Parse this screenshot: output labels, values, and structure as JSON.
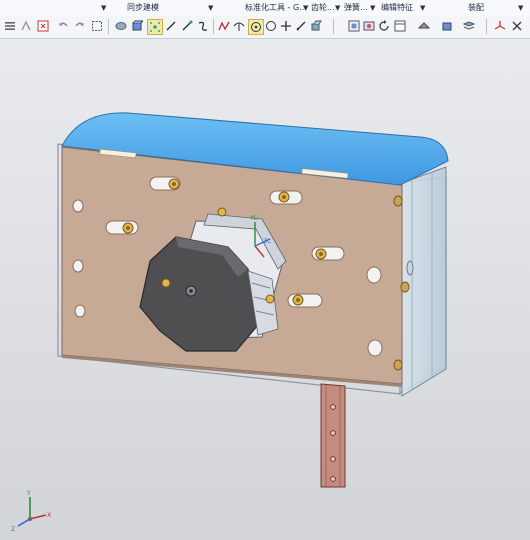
{
  "ribbon": {
    "groups": [
      {
        "label": "同步建模"
      },
      {
        "label": "标准化工具 - G..."
      },
      {
        "label": "齿轮..."
      },
      {
        "label": "弹簧..."
      },
      {
        "label": "编辑特征"
      },
      {
        "label": "装配"
      }
    ]
  },
  "toolbar": {
    "icons": [
      "menu-icon",
      "snap-icon",
      "select-filter-icon",
      "undo-icon",
      "redo-icon",
      "box-select-icon",
      "shaded-view-icon",
      "solid-view-icon",
      "point-snap-icon",
      "line-snap-icon",
      "edge-snap-icon",
      "curve-snap-icon",
      "intersection-icon",
      "center-snap-icon",
      "circle-snap-icon",
      "cross-snap-icon",
      "tangent-snap-icon",
      "orient-icon",
      "fit-view-icon",
      "render-icon",
      "rotate-icon",
      "display-mode-icon",
      "section-icon",
      "material-icon",
      "layer-icon",
      "view-triad-icon",
      "measure-icon",
      "analysis-icon",
      "wrench-icon"
    ]
  },
  "viewport": {
    "triad_axes": [
      "X",
      "Y",
      "Z"
    ],
    "model_triad": [
      "XC",
      "YC",
      "ZC"
    ],
    "colors": {
      "top_face": "#5aaee8",
      "plate": "#c8ab96",
      "motor": "#555555",
      "rail": "#c58b7e",
      "bolt": "#e0b84a"
    }
  }
}
